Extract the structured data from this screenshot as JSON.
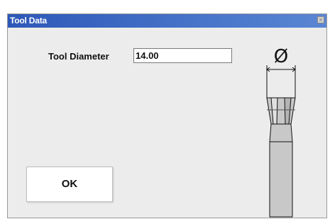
{
  "window": {
    "title": "Tool Data",
    "close_glyph": "×"
  },
  "form": {
    "diameter_label": "Tool Diameter",
    "diameter_value": "14.00"
  },
  "buttons": {
    "ok_label": "OK"
  },
  "diagram": {
    "diameter_symbol": "Ø"
  },
  "icons": {
    "close": "close-icon",
    "tool": "end-mill-tool-icon"
  },
  "colors": {
    "titlebar": "#2d58b8",
    "tool_fill": "#c8c8c8"
  }
}
